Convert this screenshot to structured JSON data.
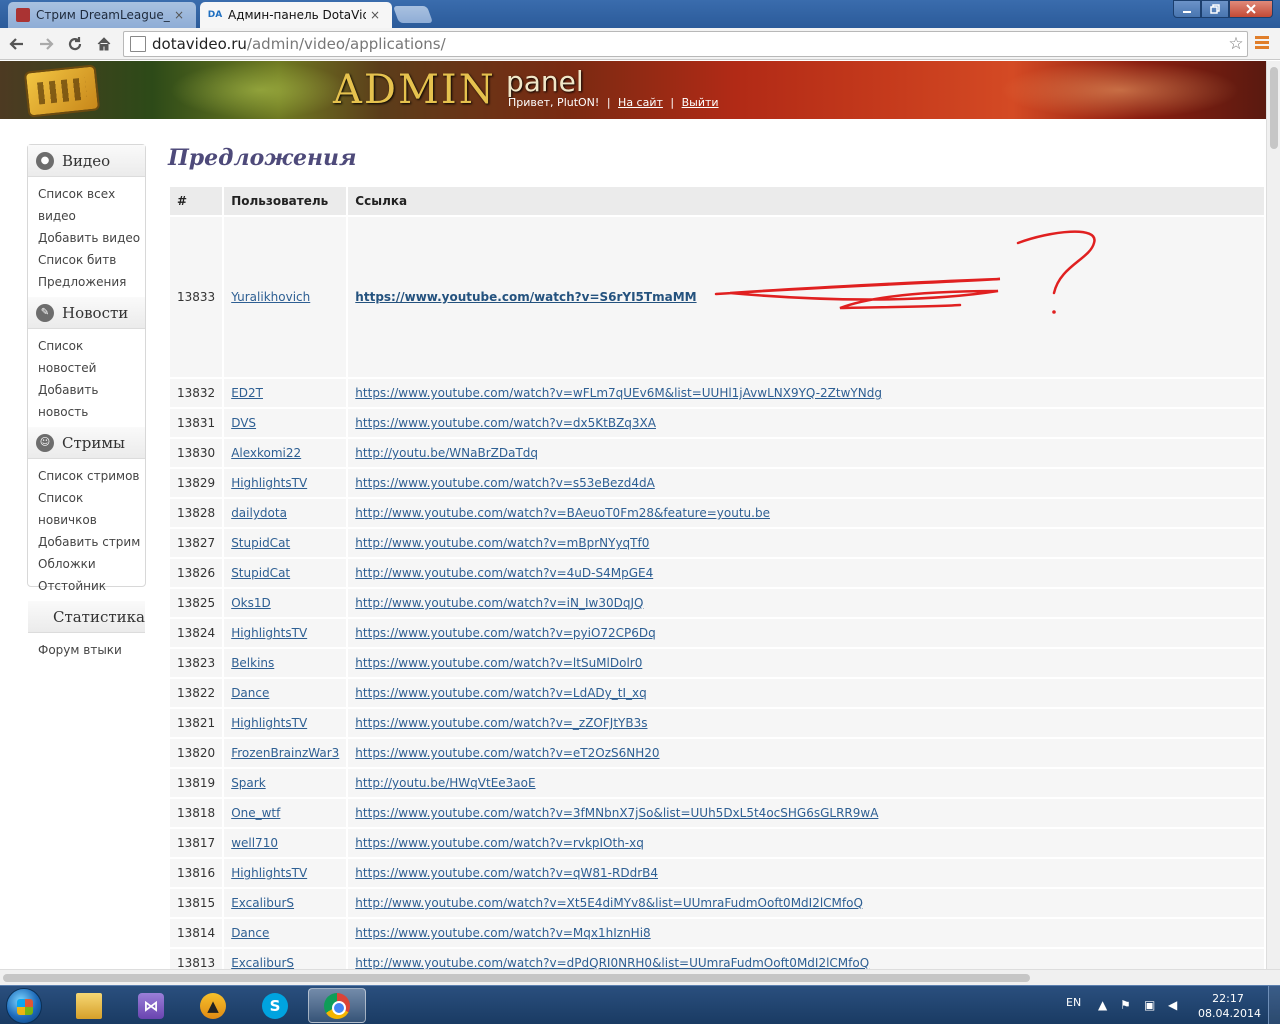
{
  "browser": {
    "tabs": [
      {
        "title": "Стрим DreamLeague_",
        "close": "×"
      },
      {
        "title": "Админ-панель DotaVideo",
        "favicon": "DA",
        "close": "×"
      }
    ],
    "url_host": "dotavideo.ru",
    "url_path": "/admin/video/applications/",
    "icons": {
      "back": "arrow-left",
      "forward": "arrow-right",
      "reload": "reload",
      "home": "home",
      "star": "star",
      "menu": "hamburger"
    }
  },
  "banner": {
    "brand": "ADMIN",
    "brand_sub": "panel",
    "greeting": "Привет, PlutON!",
    "site_link": "На сайт",
    "logout_link": "Выйти",
    "separator": "|"
  },
  "sidebar": {
    "sections": [
      {
        "title": "Видео",
        "icon": "apple-icon",
        "items": [
          "Список всех видео",
          "Добавить видео",
          "Список битв",
          "Предложения"
        ]
      },
      {
        "title": "Новости",
        "icon": "pin-icon",
        "items": [
          "Список новостей",
          "Добавить новость"
        ]
      },
      {
        "title": "Стримы",
        "icon": "robot-icon",
        "items": [
          "Список стримов",
          "Список новичков",
          "Добавить стрим",
          "Обложки",
          "Отстойник"
        ]
      },
      {
        "title": "Статистика",
        "icon": "",
        "items": [
          "Форум втыки"
        ]
      }
    ]
  },
  "main": {
    "title": "Предложения",
    "columns": [
      "#",
      "Пользователь",
      "Ссылка"
    ],
    "rows": [
      {
        "id": "13833",
        "user": "Yuralikhovich",
        "link": "https://www.youtube.com/watch?v=S6rYI5TmaMM"
      },
      {
        "id": "13832",
        "user": "ED2T",
        "link": "https://www.youtube.com/watch?v=wFLm7qUEv6M&list=UUHl1jAvwLNX9YQ-2ZtwYNdg"
      },
      {
        "id": "13831",
        "user": "DVS",
        "link": "https://www.youtube.com/watch?v=dx5KtBZq3XA"
      },
      {
        "id": "13830",
        "user": "Alexkomi22",
        "link": "http://youtu.be/WNaBrZDaTdq"
      },
      {
        "id": "13829",
        "user": "HighlightsTV",
        "link": "https://www.youtube.com/watch?v=s53eBezd4dA"
      },
      {
        "id": "13828",
        "user": "dailydota",
        "link": "http://www.youtube.com/watch?v=BAeuoT0Fm28&feature=youtu.be"
      },
      {
        "id": "13827",
        "user": "StupidCat",
        "link": "http://www.youtube.com/watch?v=mBprNYyqTf0"
      },
      {
        "id": "13826",
        "user": "StupidCat",
        "link": "http://www.youtube.com/watch?v=4uD-S4MpGE4"
      },
      {
        "id": "13825",
        "user": "Oks1D",
        "link": "http://www.youtube.com/watch?v=iN_Iw30DqJQ"
      },
      {
        "id": "13824",
        "user": "HighlightsTV",
        "link": "https://www.youtube.com/watch?v=pyiO72CP6Dq"
      },
      {
        "id": "13823",
        "user": "Belkins",
        "link": "https://www.youtube.com/watch?v=ltSuMlDolr0"
      },
      {
        "id": "13822",
        "user": "Dance",
        "link": "https://www.youtube.com/watch?v=LdADy_tI_xq"
      },
      {
        "id": "13821",
        "user": "HighlightsTV",
        "link": "https://www.youtube.com/watch?v=_zZOFJtYB3s"
      },
      {
        "id": "13820",
        "user": "FrozenBrainzWar3",
        "link": "https://www.youtube.com/watch?v=eT2OzS6NH20"
      },
      {
        "id": "13819",
        "user": "Spark",
        "link": "http://youtu.be/HWqVtEe3aoE"
      },
      {
        "id": "13818",
        "user": "One_wtf",
        "link": "https://www.youtube.com/watch?v=3fMNbnX7jSo&list=UUh5DxL5t4ocSHG6sGLRR9wA"
      },
      {
        "id": "13817",
        "user": "well710",
        "link": "https://www.youtube.com/watch?v=rvkpIOth-xq"
      },
      {
        "id": "13816",
        "user": "HighlightsTV",
        "link": "https://www.youtube.com/watch?v=qW81-RDdrB4"
      },
      {
        "id": "13815",
        "user": "ExcaliburS",
        "link": "http://www.youtube.com/watch?v=Xt5E4diMYv8&list=UUmraFudmOoft0MdI2lCMfoQ"
      },
      {
        "id": "13814",
        "user": "Dance",
        "link": "https://www.youtube.com/watch?v=Mqx1hIznHi8"
      },
      {
        "id": "13813",
        "user": "ExcaliburS",
        "link": "http://www.youtube.com/watch?v=dPdQRI0NRH0&list=UUmraFudmOoft0MdI2lCMfoQ"
      }
    ],
    "annotation": {
      "color": "#e02020"
    }
  },
  "taskbar": {
    "apps": [
      "explorer-icon",
      "visual-studio-icon",
      "aimp-icon",
      "skype-icon",
      "chrome-icon"
    ],
    "language": "EN",
    "time": "22:17",
    "date": "08.04.2014"
  },
  "colors": {
    "link": "#2e5f93",
    "title": "#4e4a7a",
    "accent": "#e07e2a"
  }
}
